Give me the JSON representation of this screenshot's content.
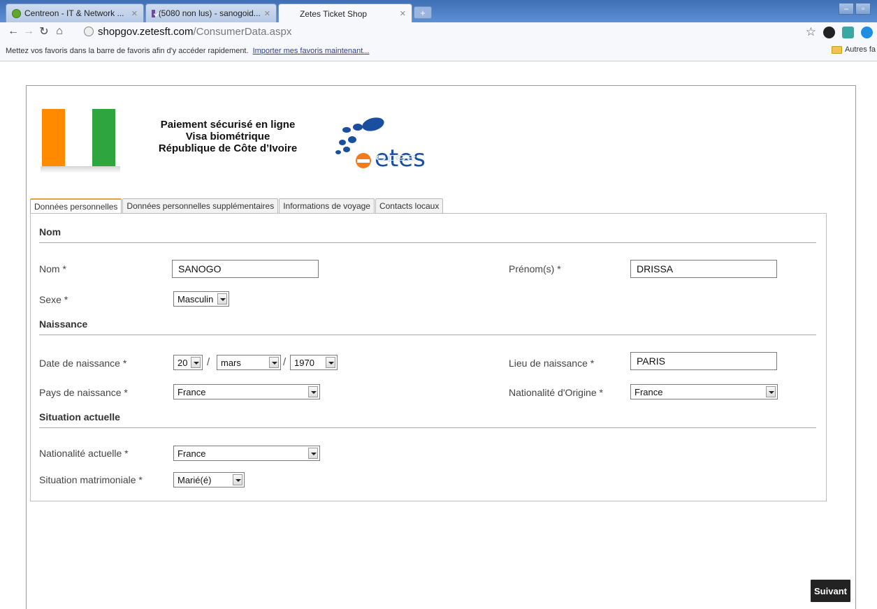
{
  "browser": {
    "tabs": [
      {
        "title": "Centreon - IT & Network ...",
        "icon": "centreon-icon"
      },
      {
        "title": "(5080 non lus) - sanogoid...",
        "icon": "mail-icon"
      },
      {
        "title": "Zetes Ticket Shop",
        "icon": ""
      }
    ],
    "url_host": "shopgov.zetesft.com",
    "url_path": "/ConsumerData.aspx",
    "bookmarks_hint": "Mettez vos favoris dans la barre de favoris afin d'y accéder rapidement.",
    "bookmarks_link": "Importer mes favoris maintenant...",
    "other_bookmarks": "Autres fa"
  },
  "header": {
    "line1": "Paiement sécurisé en ligne",
    "line2": "Visa biométrique",
    "line3": "République de Côte d’Ivoire",
    "logo_text": "etes",
    "colors": {
      "flag_orange": "#ff8a00",
      "flag_green": "#2fa53f",
      "zetes_blue": "#1a4fa0",
      "zetes_orange": "#f07c1e"
    }
  },
  "form_tabs": [
    "Données personnelles",
    "Données personnelles supplémentaires",
    "Informations de voyage",
    "Contacts locaux"
  ],
  "sections": {
    "nom": "Nom",
    "naissance": "Naissance",
    "situation": "Situation actuelle"
  },
  "fields": {
    "nom": {
      "label": "Nom *",
      "value": "SANOGO"
    },
    "prenom": {
      "label": "Prénom(s) *",
      "value": "DRISSA"
    },
    "sexe": {
      "label": "Sexe *",
      "value": "Masculin"
    },
    "date_naissance": {
      "label": "Date de naissance *",
      "day": "20",
      "month": "mars",
      "year": "1970",
      "separator": "/"
    },
    "lieu_naissance": {
      "label": "Lieu de naissance *",
      "value": "PARIS"
    },
    "pays_naissance": {
      "label": "Pays de naissance *",
      "value": "France"
    },
    "nationalite_origine": {
      "label": "Nationalité d'Origine *",
      "value": "France"
    },
    "nationalite_actuelle": {
      "label": "Nationalité actuelle *",
      "value": "France"
    },
    "situation_matrimoniale": {
      "label": "Situation matrimoniale *",
      "value": "Marié(é)"
    }
  },
  "next_button": "Suivant"
}
